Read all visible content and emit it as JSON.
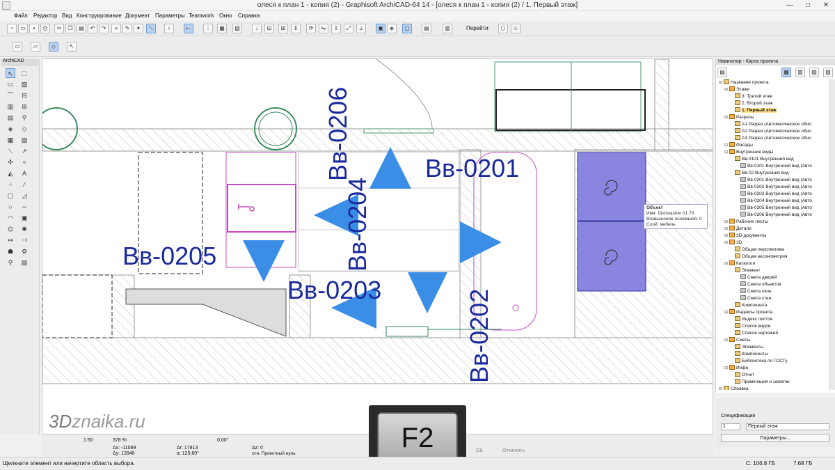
{
  "window": {
    "title": "олеся к план 1 - копия (2) - Graphisoft ArchiCAD-64 14 - [олеся к план 1 - копия (2) / 1. Первый этаж]",
    "min": "—",
    "max": "□",
    "close": "✕"
  },
  "menu": [
    "Файл",
    "Редактор",
    "Вид",
    "Конструирование",
    "Документ",
    "Параметры",
    "Teamwork",
    "Окно",
    "Справка"
  ],
  "toolbar": {
    "goto_label": "Перейти"
  },
  "toolbox": {
    "title": "ArchiCAD"
  },
  "canvas": {
    "labels": {
      "v0201": "Вв-0201",
      "v0202": "Вв-0202",
      "v0203": "Вв-0203",
      "v0204": "Вв-0204",
      "v0205": "Вв-0205",
      "v0206": "Вв-0206"
    },
    "tooltip": {
      "title": "Объект",
      "line1": "Имя: Dishwasher 01 70",
      "line2": "Возвышение основания: 0",
      "line3": "Слой: мебель"
    },
    "marker_color": "#3a8ee6",
    "label_color": "#1a2a9c"
  },
  "navigator": {
    "title": "Навигатор - Карта проекта",
    "items": [
      {
        "t": "Название проекта",
        "lvl": 0
      },
      {
        "t": "Этажи",
        "lvl": 1
      },
      {
        "t": "3. Третий этаж",
        "lvl": 2
      },
      {
        "t": "2. Второй этаж",
        "lvl": 2
      },
      {
        "t": "1. Первый этаж",
        "lvl": 2,
        "sel": true
      },
      {
        "t": "Разрезы",
        "lvl": 1
      },
      {
        "t": "A1 Разрез (Автоматическое обно",
        "lvl": 2
      },
      {
        "t": "A2 Разрез (Автоматическое обно",
        "lvl": 2
      },
      {
        "t": "A3 Разрез (Автоматическое обно",
        "lvl": 2
      },
      {
        "t": "Фасады",
        "lvl": 1
      },
      {
        "t": "Внутренние виды",
        "lvl": 1
      },
      {
        "t": "Вв-0101 Внутренний вид",
        "lvl": 2
      },
      {
        "t": "Вв-0101 Внутренний вид (Авто",
        "lvl": 3
      },
      {
        "t": "Вв-02 Внутренний вид",
        "lvl": 2
      },
      {
        "t": "Вв-0201 Внутренний вид (Авто",
        "lvl": 3
      },
      {
        "t": "Вв-0202 Внутренний вид (Авто",
        "lvl": 3
      },
      {
        "t": "Вв-0203 Внутренний вид (Авто",
        "lvl": 3
      },
      {
        "t": "Вв-0204 Внутренний вид (Авто",
        "lvl": 3
      },
      {
        "t": "Вв-0205 Внутренний вид (Авто",
        "lvl": 3
      },
      {
        "t": "Вв-0206 Внутренний вид (Авто",
        "lvl": 3
      },
      {
        "t": "Рабочие листы",
        "lvl": 1
      },
      {
        "t": "Детали",
        "lvl": 1
      },
      {
        "t": "3D-документы",
        "lvl": 1
      },
      {
        "t": "3D",
        "lvl": 1
      },
      {
        "t": "Общая перспектива",
        "lvl": 2
      },
      {
        "t": "Общая аксонометрия",
        "lvl": 2
      },
      {
        "t": "Каталоги",
        "lvl": 1
      },
      {
        "t": "Элемент",
        "lvl": 2
      },
      {
        "t": "Смета дверей",
        "lvl": 3
      },
      {
        "t": "Смета объектов",
        "lvl": 3
      },
      {
        "t": "Смета окон",
        "lvl": 3
      },
      {
        "t": "Смета стен",
        "lvl": 3
      },
      {
        "t": "Компонента",
        "lvl": 2
      },
      {
        "t": "Индексы проекта",
        "lvl": 1
      },
      {
        "t": "Индекс листов",
        "lvl": 2
      },
      {
        "t": "Список видов",
        "lvl": 2
      },
      {
        "t": "Список чертежей",
        "lvl": 2
      },
      {
        "t": "Сметы",
        "lvl": 1
      },
      {
        "t": "Элементы",
        "lvl": 2
      },
      {
        "t": "Компоненты",
        "lvl": 2
      },
      {
        "t": "Библиотека по ГОСТу",
        "lvl": 2
      },
      {
        "t": "Инфо",
        "lvl": 1
      },
      {
        "t": "Отчет",
        "lvl": 2
      },
      {
        "t": "Примечания и заметки",
        "lvl": 2
      },
      {
        "t": "Справка",
        "lvl": 0
      }
    ],
    "spec_label": "Спецификации",
    "floor_value": "Первый этаж",
    "floor_num": "1",
    "params_button": "Параметры..."
  },
  "bottom": {
    "scale": "1:50",
    "zoom": "378 %",
    "angle": "0,00°",
    "dx": "Δx: -11089",
    "dy": "Δy: 13940",
    "da": "Δr: 17813",
    "dangle": "a: 129,60°",
    "dz_label": "Δz: 0",
    "ref": "отн. Проектный нуль",
    "ok": "OK",
    "cancel": "Отменить"
  },
  "status": {
    "hint": "Щелкните элемент или начертите область выбора.",
    "disk_c": "C: 106.8 ГБ",
    "ram": "7.68 ГБ"
  },
  "overlay": {
    "key": "F2",
    "logo_3d": "3D",
    "logo_rest": "znaika.ru"
  }
}
